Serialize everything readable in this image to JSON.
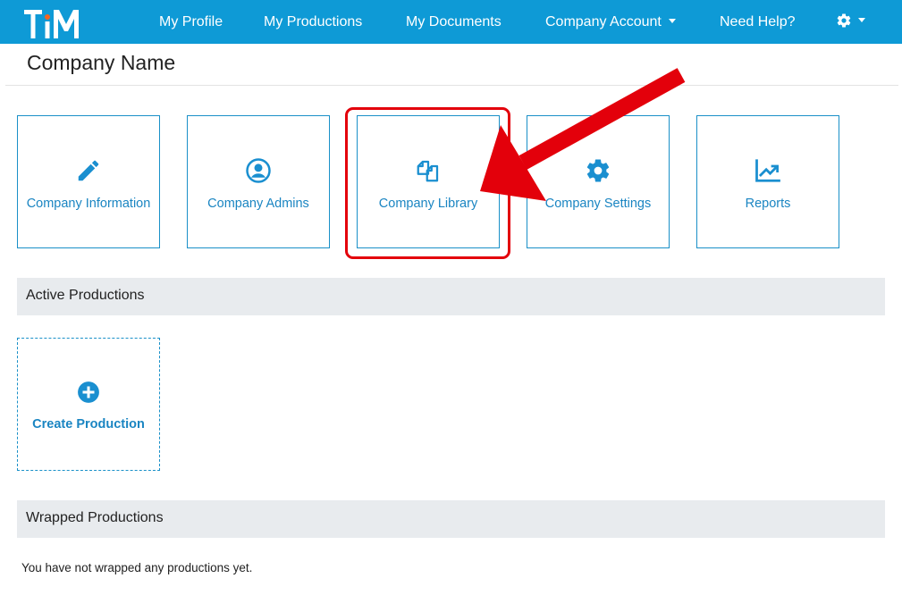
{
  "nav": {
    "logo_text": "TiM",
    "items": [
      {
        "label": "My Profile"
      },
      {
        "label": "My Productions"
      },
      {
        "label": "My Documents"
      },
      {
        "label": "Company Account"
      },
      {
        "label": "Need Help?"
      }
    ]
  },
  "page": {
    "title": "Company Name"
  },
  "tiles": [
    {
      "label": "Company Information",
      "icon": "pencil-icon"
    },
    {
      "label": "Company Admins",
      "icon": "user-circle-icon"
    },
    {
      "label": "Company Library",
      "icon": "documents-icon"
    },
    {
      "label": "Company Settings",
      "icon": "gear-icon"
    },
    {
      "label": "Reports",
      "icon": "chart-line-icon"
    }
  ],
  "active_productions": {
    "heading": "Active Productions",
    "create_label": "Create Production"
  },
  "wrapped_productions": {
    "heading": "Wrapped Productions",
    "empty_text": "You have not wrapped any productions yet."
  },
  "colors": {
    "nav_bg": "#0e9ad6",
    "accent": "#1a85c2",
    "highlight": "#e3000b",
    "section_bg": "#e8ebee"
  }
}
